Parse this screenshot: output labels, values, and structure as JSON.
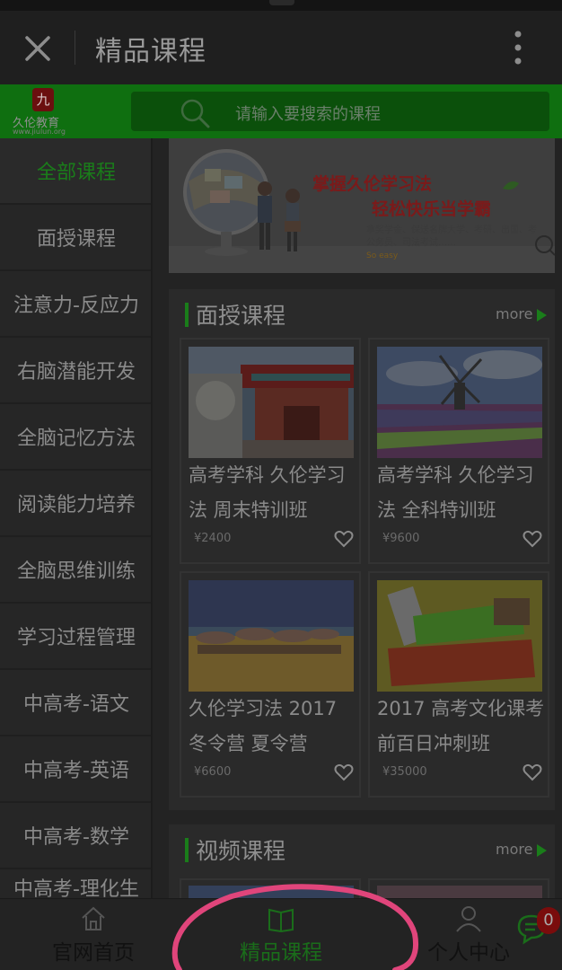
{
  "header": {
    "title": "精品课程"
  },
  "logo": {
    "mark": "九",
    "brand": "久伦教育",
    "url": "www.jiulun.org"
  },
  "search": {
    "placeholder": "请输入要搜索的课程"
  },
  "sidebar": {
    "items": [
      {
        "label": "全部课程",
        "active": true
      },
      {
        "label": "面授课程",
        "active": false
      },
      {
        "label": "注意力-反应力",
        "active": false
      },
      {
        "label": "右脑潜能开发",
        "active": false
      },
      {
        "label": "全脑记忆方法",
        "active": false
      },
      {
        "label": "阅读能力培养",
        "active": false
      },
      {
        "label": "全脑思维训练",
        "active": false
      },
      {
        "label": "学习过程管理",
        "active": false
      },
      {
        "label": "中高考-语文",
        "active": false
      },
      {
        "label": "中高考-英语",
        "active": false
      },
      {
        "label": "中高考-数学",
        "active": false
      },
      {
        "label": "中高考-理化生",
        "active": false
      }
    ]
  },
  "banner": {
    "headline": "掌握久伦学习法",
    "subline": "轻松快乐当学霸",
    "desc": "拿奖学金、保送名牌大学、考研、出国、考公务员、司法考试……",
    "easy": "So easy"
  },
  "sections": [
    {
      "title": "面授课程",
      "more": "more",
      "cards": [
        {
          "title": "高考学科 久伦学习法 周末特训班",
          "price": "¥2400"
        },
        {
          "title": "高考学科 久伦学习法 全科特训班",
          "price": "¥9600"
        },
        {
          "title": "久伦学习法 2017 冬令营 夏令营",
          "price": "¥6600"
        },
        {
          "title": "2017 高考文化课考前百日冲刺班",
          "price": "¥35000"
        }
      ]
    },
    {
      "title": "视频课程",
      "more": "more"
    }
  ],
  "tabbar": {
    "items": [
      {
        "label": "官网首页",
        "icon": "home-icon"
      },
      {
        "label": "精品课程",
        "icon": "book-icon",
        "active": true
      },
      {
        "label": "个人中心",
        "icon": "person-icon"
      }
    ],
    "chat_badge": "0"
  },
  "colors": {
    "accent_green": "#1a7d1a",
    "header_green": "#0f6f10",
    "annotation": "#e0457b"
  }
}
